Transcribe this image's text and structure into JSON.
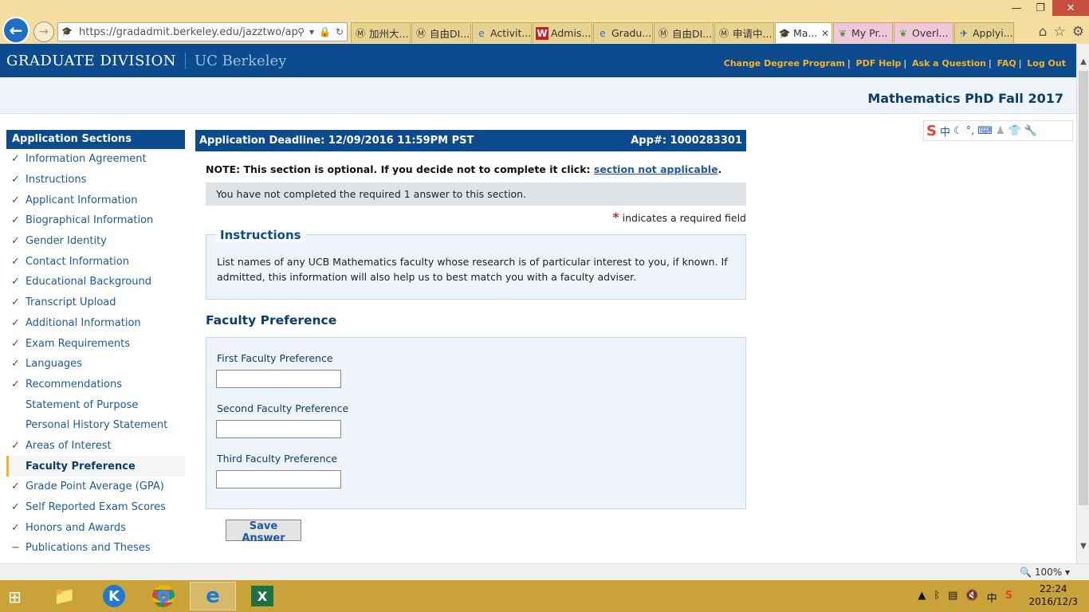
{
  "browser": {
    "url": "https://gradadmit.berkeley.edu/jazztwo/app/a",
    "tabs": [
      {
        "label": "加州大...",
        "icon": "M"
      },
      {
        "label": "自由DI...",
        "icon": "M"
      },
      {
        "label": "Activit...",
        "icon": "e"
      },
      {
        "label": "Admis...",
        "icon": "W"
      },
      {
        "label": "Gradu...",
        "icon": "e"
      },
      {
        "label": "自由DI...",
        "icon": "M"
      },
      {
        "label": "申请中...",
        "icon": "M"
      },
      {
        "label": "Ma...",
        "icon": "cap"
      },
      {
        "label": "My Pr...",
        "icon": "leaf"
      },
      {
        "label": "Overl...",
        "icon": "leaf"
      },
      {
        "label": "Applyi...",
        "icon": "plane"
      }
    ]
  },
  "header": {
    "title": "GRADUATE DIVISION",
    "subtitle": "UC Berkeley",
    "links": [
      "Change Degree Program",
      "PDF Help",
      "Ask a Question",
      "FAQ",
      "Log Out"
    ]
  },
  "program": "Mathematics PhD Fall 2017",
  "ime": {
    "logo": "S",
    "mode": "中"
  },
  "sidebar": {
    "heading": "Application Sections",
    "items": [
      {
        "label": "Information Agreement",
        "mark": "✓"
      },
      {
        "label": "Instructions",
        "mark": "✓"
      },
      {
        "label": "Applicant Information",
        "mark": "✓"
      },
      {
        "label": "Biographical Information",
        "mark": "✓"
      },
      {
        "label": "Gender Identity",
        "mark": "✓"
      },
      {
        "label": "Contact Information",
        "mark": "✓"
      },
      {
        "label": "Educational Background",
        "mark": "✓"
      },
      {
        "label": "Transcript Upload",
        "mark": "✓"
      },
      {
        "label": "Additional Information",
        "mark": "✓"
      },
      {
        "label": "Exam Requirements",
        "mark": "✓"
      },
      {
        "label": "Languages",
        "mark": "✓"
      },
      {
        "label": "Recommendations",
        "mark": "✓"
      },
      {
        "label": "Statement of Purpose",
        "mark": ""
      },
      {
        "label": "Personal History Statement",
        "mark": ""
      },
      {
        "label": "Areas of Interest",
        "mark": "✓"
      },
      {
        "label": "Faculty Preference",
        "mark": ""
      },
      {
        "label": "Grade Point Average (GPA)",
        "mark": "✓"
      },
      {
        "label": "Self Reported Exam Scores",
        "mark": "✓"
      },
      {
        "label": "Honors and Awards",
        "mark": "✓"
      },
      {
        "label": "Publications and Theses",
        "mark": "−"
      }
    ]
  },
  "deadline": {
    "label": "Application Deadline: 12/09/2016 11:59PM PST",
    "app_number": "App#: 1000283301"
  },
  "note": {
    "text": "NOTE: This section is optional. If you decide not to complete it click:",
    "link": "section not applicable",
    "end": "."
  },
  "status_message": "You have not completed the required 1 answer to this section.",
  "required_note": {
    "star": "*",
    "text": " indicates a required field"
  },
  "instructions": {
    "heading": "Instructions",
    "text": "List names of any UCB Mathematics faculty whose research is of particular interest to you, if known. If admitted, this information will also help us to best match you with a faculty adviser."
  },
  "faculty_preference": {
    "heading": "Faculty Preference",
    "fields": [
      {
        "label": "First Faculty Preference",
        "value": ""
      },
      {
        "label": "Second Faculty Preference",
        "value": ""
      },
      {
        "label": "Third Faculty Preference",
        "value": ""
      }
    ]
  },
  "save_button": "Save Answer",
  "statusbar": {
    "zoom": "100%"
  },
  "taskbar": {
    "apps": [
      "file-explorer",
      "kuaipan",
      "chrome",
      "internet-explorer",
      "excel"
    ],
    "tray_ime": "中",
    "time": "22:24",
    "date": "2016/12/3"
  }
}
